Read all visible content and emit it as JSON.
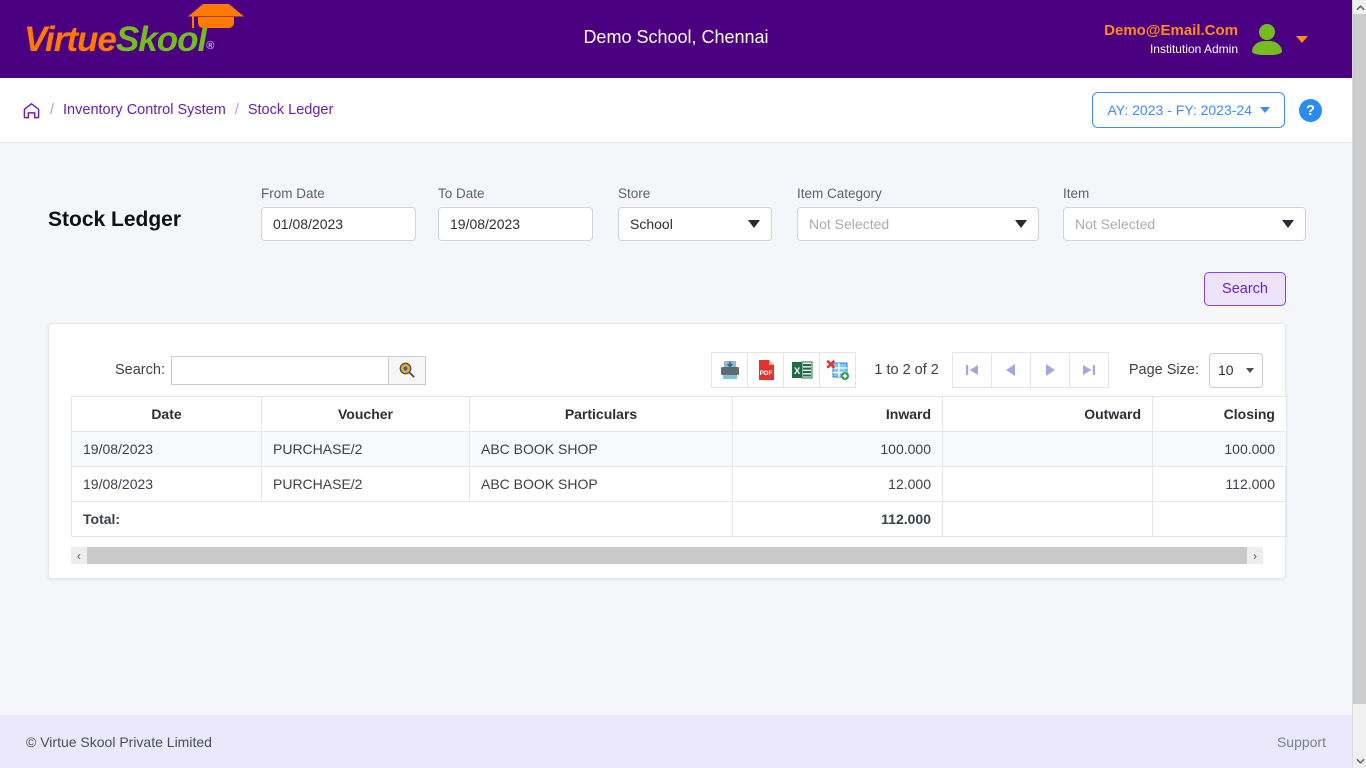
{
  "topbar": {
    "logo_virtue": "Virtue",
    "logo_skool": "Skool",
    "logo_reg": "®",
    "school_title": "Demo School, Chennai",
    "user_email": "Demo@Email.Com",
    "user_role": "Institution Admin"
  },
  "breadcrumb": {
    "home_icon": "home-icon",
    "sep": "/",
    "item1": "Inventory Control System",
    "item2": "Stock Ledger",
    "ay_label": "AY: 2023 - FY: 2023-24",
    "help_label": "?"
  },
  "filters": {
    "page_title": "Stock Ledger",
    "from_date": {
      "label": "From Date",
      "value": "01/08/2023"
    },
    "to_date": {
      "label": "To Date",
      "value": "19/08/2023"
    },
    "store": {
      "label": "Store",
      "value": "School",
      "is_placeholder": false
    },
    "item_category": {
      "label": "Item Category",
      "value": "Not Selected",
      "is_placeholder": true
    },
    "item": {
      "label": "Item",
      "value": "Not Selected",
      "is_placeholder": true
    },
    "search_button": "Search"
  },
  "toolbar": {
    "search_label": "Search:",
    "search_value": "",
    "search_placeholder": "",
    "search_icon": "magnifier-icon",
    "exports": [
      {
        "name": "print-icon",
        "title": "Print"
      },
      {
        "name": "pdf-icon",
        "title": "PDF",
        "text": "PDF"
      },
      {
        "name": "excel-icon",
        "title": "Excel",
        "text": "X"
      },
      {
        "name": "excel-export-icon",
        "title": "Export Excel"
      }
    ],
    "page_info": "1 to 2 of 2",
    "pager": [
      {
        "name": "first-page-button",
        "glyph": "first"
      },
      {
        "name": "prev-page-button",
        "glyph": "prev"
      },
      {
        "name": "next-page-button",
        "glyph": "next"
      },
      {
        "name": "last-page-button",
        "glyph": "last"
      }
    ],
    "page_size_label": "Page Size:",
    "page_size_value": "10"
  },
  "table": {
    "columns": [
      "Date",
      "Voucher",
      "Particulars",
      "Inward",
      "Outward",
      "Closing"
    ],
    "rows": [
      {
        "date": "19/08/2023",
        "voucher": "PURCHASE/2",
        "particulars": "ABC BOOK SHOP",
        "inward": "100.000",
        "outward": "",
        "closing": "100.000"
      },
      {
        "date": "19/08/2023",
        "voucher": "PURCHASE/2",
        "particulars": "ABC BOOK SHOP",
        "inward": "12.000",
        "outward": "",
        "closing": "112.000"
      }
    ],
    "total": {
      "label": "Total:",
      "inward": "112.000",
      "outward": "",
      "closing": ""
    }
  },
  "scrollbar": {
    "left_arrow": "‹",
    "right_arrow": "›",
    "up_arrow": "⌃"
  },
  "footer": {
    "copyright": "© Virtue Skool Private Limited",
    "support": "Support"
  },
  "colors": {
    "brand_purple": "#4b0082",
    "brand_orange": "#ff7a00",
    "brand_green": "#76bc21",
    "accent_blue": "#3d8bfd",
    "btn_purple": "#6b21c8"
  }
}
